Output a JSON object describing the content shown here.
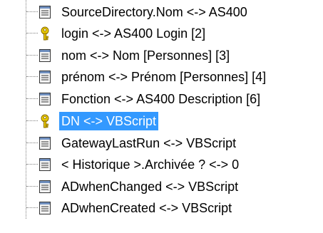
{
  "colors": {
    "selection": "#3399ff",
    "connector": "#808080",
    "key_icon": "#d4b400"
  },
  "tree": {
    "items": [
      {
        "label": "SourceDirectory.Nom <-> AS400",
        "icon": "field-icon",
        "selected": false
      },
      {
        "label": "login <-> AS400 Login [2]",
        "icon": "key-icon",
        "selected": false
      },
      {
        "label": "nom <-> Nom [Personnes] [3]",
        "icon": "field-icon",
        "selected": false
      },
      {
        "label": "prénom <-> Prénom [Personnes] [4]",
        "icon": "field-icon",
        "selected": false
      },
      {
        "label": "Fonction <-> AS400 Description [6]",
        "icon": "field-icon",
        "selected": false
      },
      {
        "label": "DN <-> VBScript",
        "icon": "key-icon",
        "selected": true
      },
      {
        "label": "GatewayLastRun <-> VBScript",
        "icon": "field-icon",
        "selected": false
      },
      {
        "label": "< Historique >.Archivée ? <-> 0",
        "icon": "field-icon",
        "selected": false
      },
      {
        "label": "ADwhenChanged <-> VBScript",
        "icon": "field-icon",
        "selected": false
      },
      {
        "label": "ADwhenCreated <-> VBScript",
        "icon": "field-icon",
        "selected": false
      }
    ]
  }
}
